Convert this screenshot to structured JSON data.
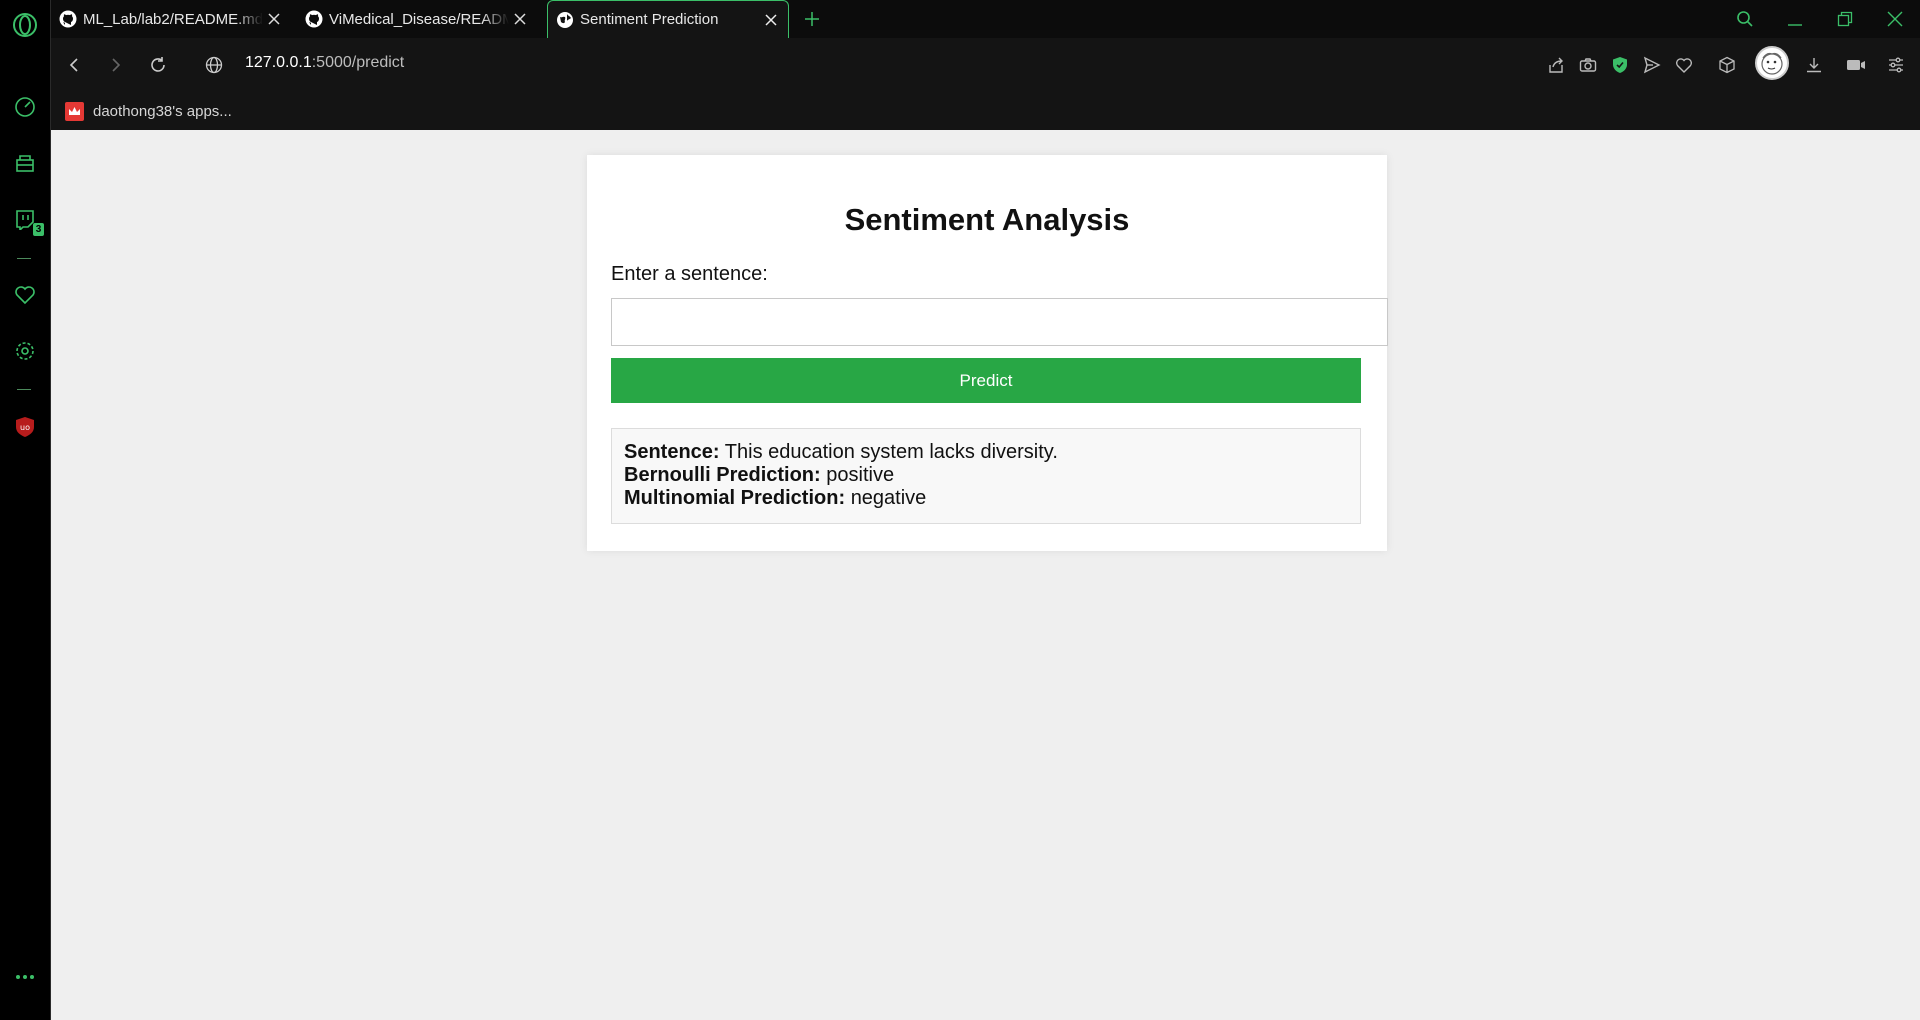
{
  "browser": {
    "tabs": [
      {
        "title": "ML_Lab/lab2/README.md at ...",
        "favicon": "github-icon",
        "active": false
      },
      {
        "title": "ViMedical_Disease/README...",
        "favicon": "github-icon",
        "active": false
      },
      {
        "title": "Sentiment Prediction",
        "favicon": "globe-icon",
        "active": true
      }
    ],
    "url": {
      "host": "127.0.0.1",
      "path": ":5000/predict"
    },
    "bookmarks": [
      {
        "label": "daothong38's apps..."
      }
    ],
    "sidebar_badge": "3",
    "accent_color": "#3bbf68"
  },
  "page": {
    "title": "Sentiment Analysis",
    "input_label": "Enter a sentence:",
    "input_value": "",
    "predict_button": "Predict",
    "result": {
      "sentence_label": "Sentence:",
      "sentence_value": "This education system lacks diversity.",
      "bernoulli_label": "Bernoulli Prediction:",
      "bernoulli_value": "positive",
      "multinomial_label": "Multinomial Prediction:",
      "multinomial_value": "negative"
    },
    "button_color": "#28a745"
  }
}
